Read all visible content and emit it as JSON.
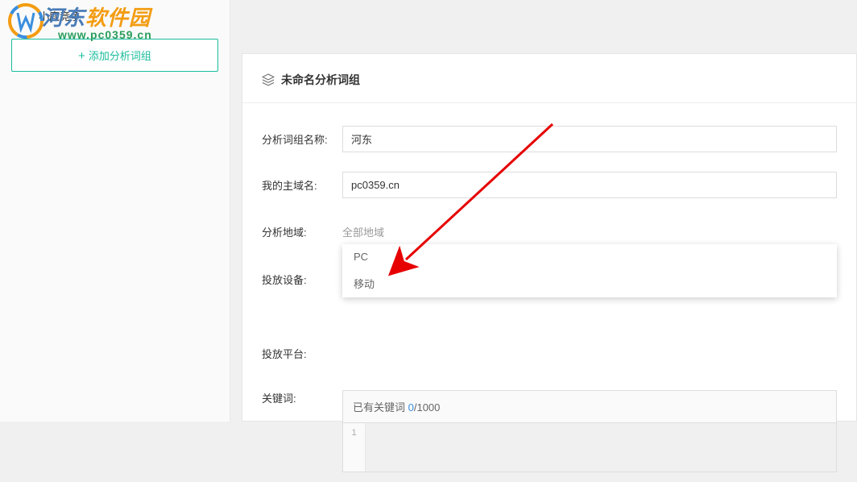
{
  "app": {
    "title": "小鹿竞争"
  },
  "watermark": {
    "line1a": "河东",
    "line1b": "软件园",
    "line2": "www.pc0359.cn"
  },
  "sidebar": {
    "add_btn": "添加分析词组"
  },
  "panel": {
    "title": "未命名分析词组"
  },
  "form": {
    "name_label": "分析词组名称:",
    "name_value": "河东",
    "domain_label": "我的主域名:",
    "domain_value": "pc0359.cn",
    "region_label": "分析地域:",
    "region_value": "全部地域",
    "device_label": "投放设备:",
    "device_value": "",
    "platform_label": "投放平台:",
    "keyword_label": "关键词:",
    "keyword_header_prefix": "已有关键词 ",
    "keyword_count": "0",
    "keyword_total": "/1000",
    "line_no": "1"
  },
  "dropdown": {
    "options": [
      "PC",
      "移动"
    ]
  }
}
